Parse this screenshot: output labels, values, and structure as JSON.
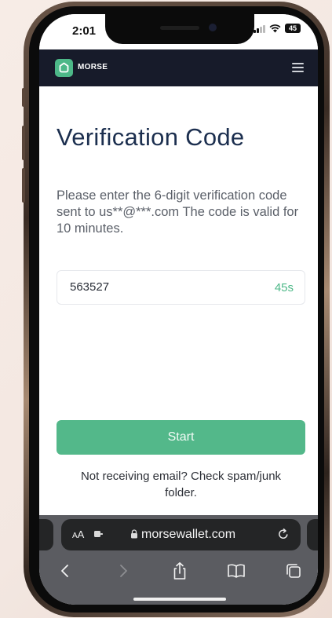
{
  "statusbar": {
    "time": "2:01",
    "battery": "45"
  },
  "header": {
    "brand": "MORSE",
    "menu_icon": "hamburger-menu-icon",
    "brand_color": "#4db888",
    "bar_color": "#171b2a"
  },
  "main": {
    "title": "Verification Code",
    "instructions": "Please enter the 6-digit verification code sent to us**@***.com The code is valid for 10 minutes.",
    "code_value": "563527",
    "countdown": "45s",
    "start_label": "Start",
    "help_text": "Not receiving email? Check spam/junk folder."
  },
  "browser": {
    "aa_small": "A",
    "aa_large": "A",
    "url": "morsewallet.com",
    "icons": [
      "extension-icon",
      "lock-icon",
      "reload-icon",
      "back-icon",
      "forward-icon",
      "share-icon",
      "bookmarks-icon",
      "tabs-icon"
    ]
  },
  "colors": {
    "accent": "#53b88a",
    "title": "#1c2f4f"
  }
}
